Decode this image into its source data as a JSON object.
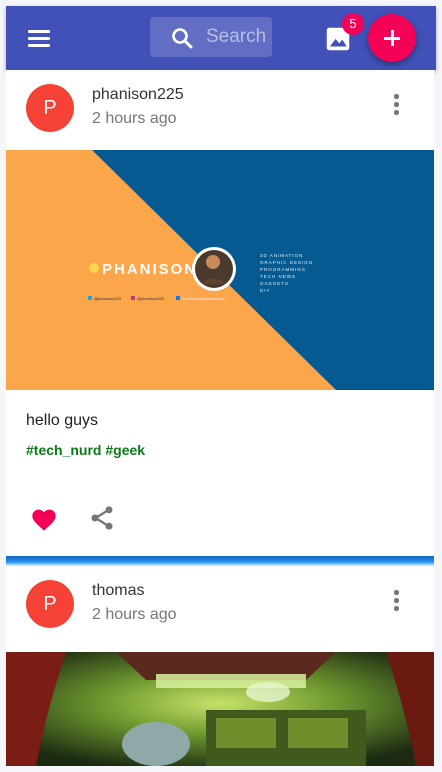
{
  "appbar": {
    "search_placeholder": "Search",
    "notification_count": "5"
  },
  "posts": [
    {
      "avatar_letter": "P",
      "username": "phanison225",
      "timestamp": "2 hours ago",
      "image": {
        "brand": "PHANISON",
        "topics": [
          "3D ANIMATION",
          "GRAPHIC DESIGN",
          "PROGRAMMING",
          "TECH NEWS",
          "GADGETS",
          "DIY"
        ],
        "socials": [
          "@phanison225",
          "@phanison225",
          "fb.com/phanikumar.besri"
        ]
      },
      "caption": "hello guys",
      "hashtags": "#tech_nurd #geek"
    },
    {
      "avatar_letter": "P",
      "username": "thomas",
      "timestamp": "2 hours ago"
    }
  ],
  "colors": {
    "appbar": "#4151b7",
    "accent": "#f50057",
    "avatar": "#f44336",
    "hashtag": "#0a7a15"
  }
}
